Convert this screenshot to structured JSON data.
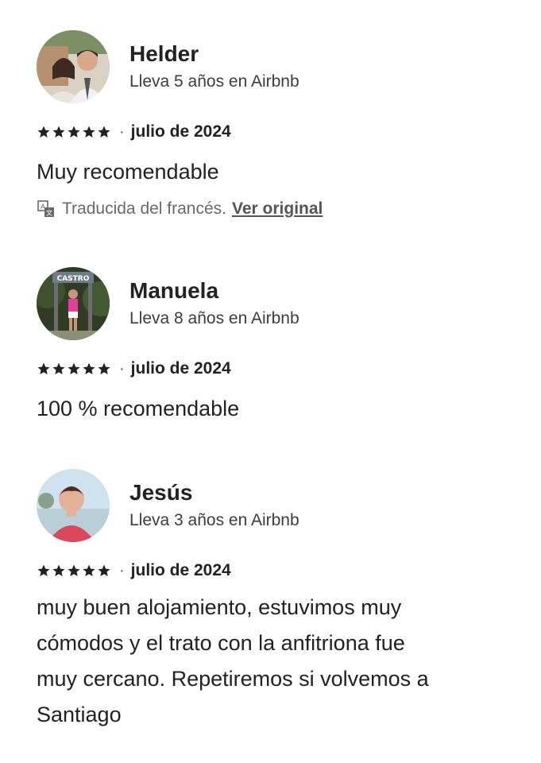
{
  "reviews": [
    {
      "name": "Helder",
      "tenure": "Lleva 5 años en Airbnb",
      "rating": 5,
      "separator": "·",
      "date": "julio de 2024",
      "text": "Muy recomendable",
      "translation": {
        "note": "Traducida del francés.",
        "link": "Ver original"
      }
    },
    {
      "name": "Manuela",
      "tenure": "Lleva 8 años en Airbnb",
      "rating": 5,
      "separator": "·",
      "date": "julio de 2024",
      "text": "100 % recomendable"
    },
    {
      "name": "Jesús",
      "tenure": "Lleva 3 años en Airbnb",
      "rating": 5,
      "separator": "·",
      "date": "julio de 2024",
      "text": "muy buen alojamiento, estuvimos muy\ncómodos y el trato con la anfitriona fue\nmuy cercano. Repetiremos si volvemos a\nSantiago"
    }
  ],
  "colors": {
    "text": "#222222",
    "secondary": "#6a6a6a",
    "star": "#222222"
  },
  "icons": {
    "star": "star-icon",
    "translate": "translate-icon"
  }
}
